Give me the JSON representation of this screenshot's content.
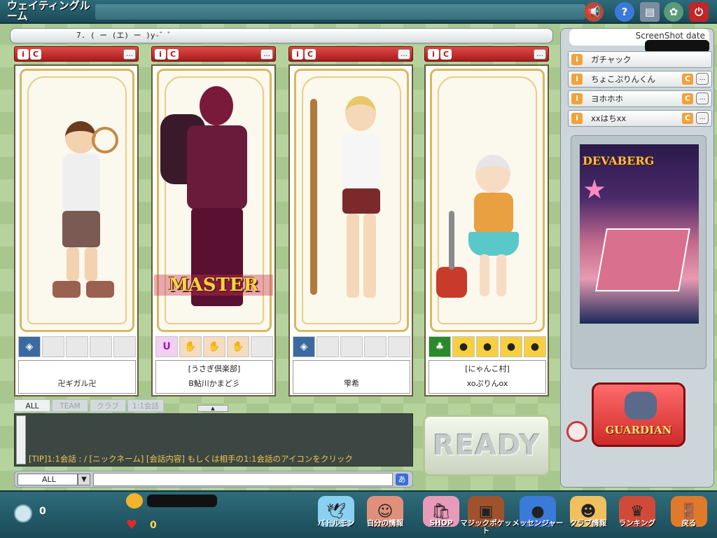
{
  "window": {
    "title": "ウェイティングルーム"
  },
  "room": {
    "info": "7. (  ー (エ) ー )y-゛゛"
  },
  "slots": [
    {
      "guild": "",
      "name": "卍ギガル卍",
      "master": false,
      "badges": [
        "rank-badge",
        "",
        "",
        "",
        ""
      ]
    },
    {
      "guild": "[うさぎ倶楽部]",
      "name": "B鮎川かまど彡",
      "master": true,
      "master_label": "MASTER",
      "badges": [
        "u-badge",
        "pet-badge",
        "pet-badge",
        "pet-badge",
        ""
      ]
    },
    {
      "guild": "",
      "name": "雫希",
      "master": false,
      "badges": [
        "rank-badge",
        "",
        "",
        "",
        ""
      ]
    },
    {
      "guild": "[にゃんこ村]",
      "name": "xoぷりんox",
      "master": false,
      "badges": [
        "clover-badge",
        "chick-badge",
        "chick-badge",
        "chick-badge",
        "chick-badge"
      ]
    }
  ],
  "right_panel": {
    "header": "ScreenShot date",
    "members": [
      {
        "name": "ガチャック",
        "club": false
      },
      {
        "name": "ちょこぷりんくん",
        "club": true
      },
      {
        "name": "ヨホホホ",
        "club": true
      },
      {
        "name": "xxはちxx",
        "club": true
      }
    ],
    "map_name": "DEVABERG",
    "guardian_label": "GUARDIAN"
  },
  "chat": {
    "tabs": [
      "ALL",
      "TEAM",
      "クラブ",
      "1:1会話"
    ],
    "active_tab": "ALL",
    "tip": "[TIP]1:1会話 : / [ニックネーム] [会話内容]  もしくは相手の1:1会話のアイコンをクリック",
    "channel": "ALL",
    "ime": "あ"
  },
  "ready_label": "READY",
  "bottom": {
    "coins": "0",
    "hearts": "0",
    "nav": [
      {
        "label": "バトルモン",
        "icon": "battlemon-icon"
      },
      {
        "label": "自分の情報",
        "icon": "profile-icon"
      },
      {
        "label": "SHOP",
        "icon": "shop-icon"
      },
      {
        "label": "マジックポケット",
        "icon": "magic-pocket-icon"
      },
      {
        "label": "メッセンジャー",
        "icon": "messenger-icon"
      },
      {
        "label": "クラブ情報",
        "icon": "club-icon"
      },
      {
        "label": "ランキング",
        "icon": "ranking-icon"
      },
      {
        "label": "戻る",
        "icon": "back-door-icon"
      }
    ]
  },
  "colors": {
    "accent_red": "#c4262a",
    "bar_teal": "#2d6b7a",
    "tip_yellow": "#f0c64a"
  }
}
